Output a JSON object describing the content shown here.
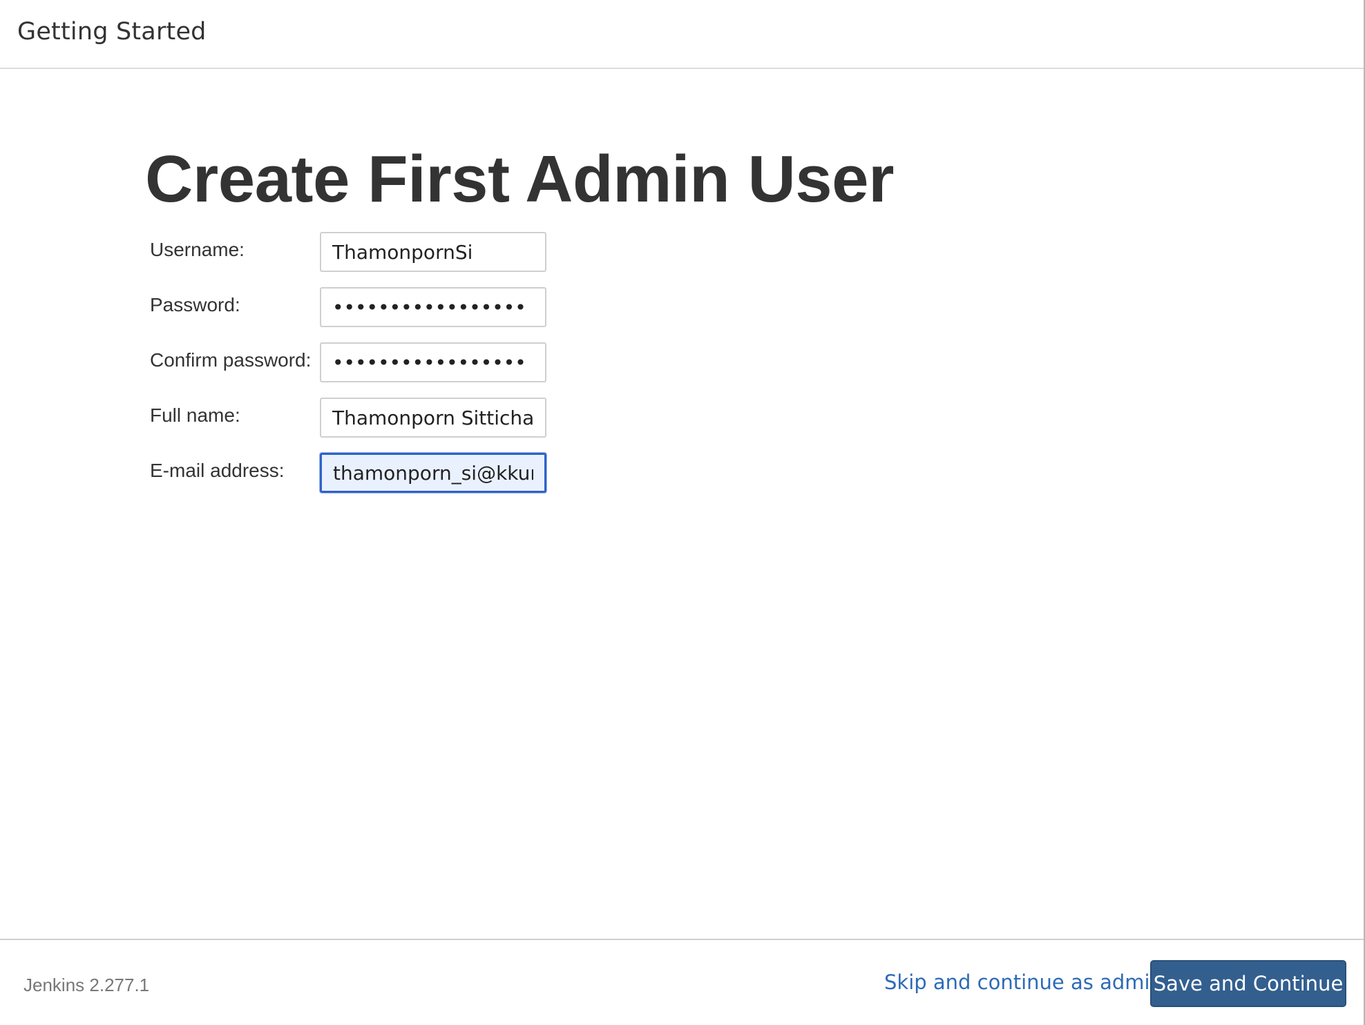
{
  "header": {
    "title": "Getting Started"
  },
  "main": {
    "page_title": "Create First Admin User",
    "fields": {
      "username": {
        "label": "Username:",
        "value": "ThamonpornSi"
      },
      "password": {
        "label": "Password:",
        "value": "•••••••••••••••••"
      },
      "confirm_password": {
        "label": "Confirm password:",
        "value": "•••••••••••••••••"
      },
      "full_name": {
        "label": "Full name:",
        "value": "Thamonporn Sittichaina"
      },
      "email": {
        "label": "E-mail address:",
        "value": "thamonporn_si@kkuma"
      }
    }
  },
  "footer": {
    "version": "Jenkins 2.277.1",
    "skip_label": "Skip and continue as admin",
    "save_label": "Save and Continue"
  },
  "colors": {
    "primary_button": "#335f8f",
    "link": "#2d6bb6",
    "focus_border": "#2f62c9"
  }
}
